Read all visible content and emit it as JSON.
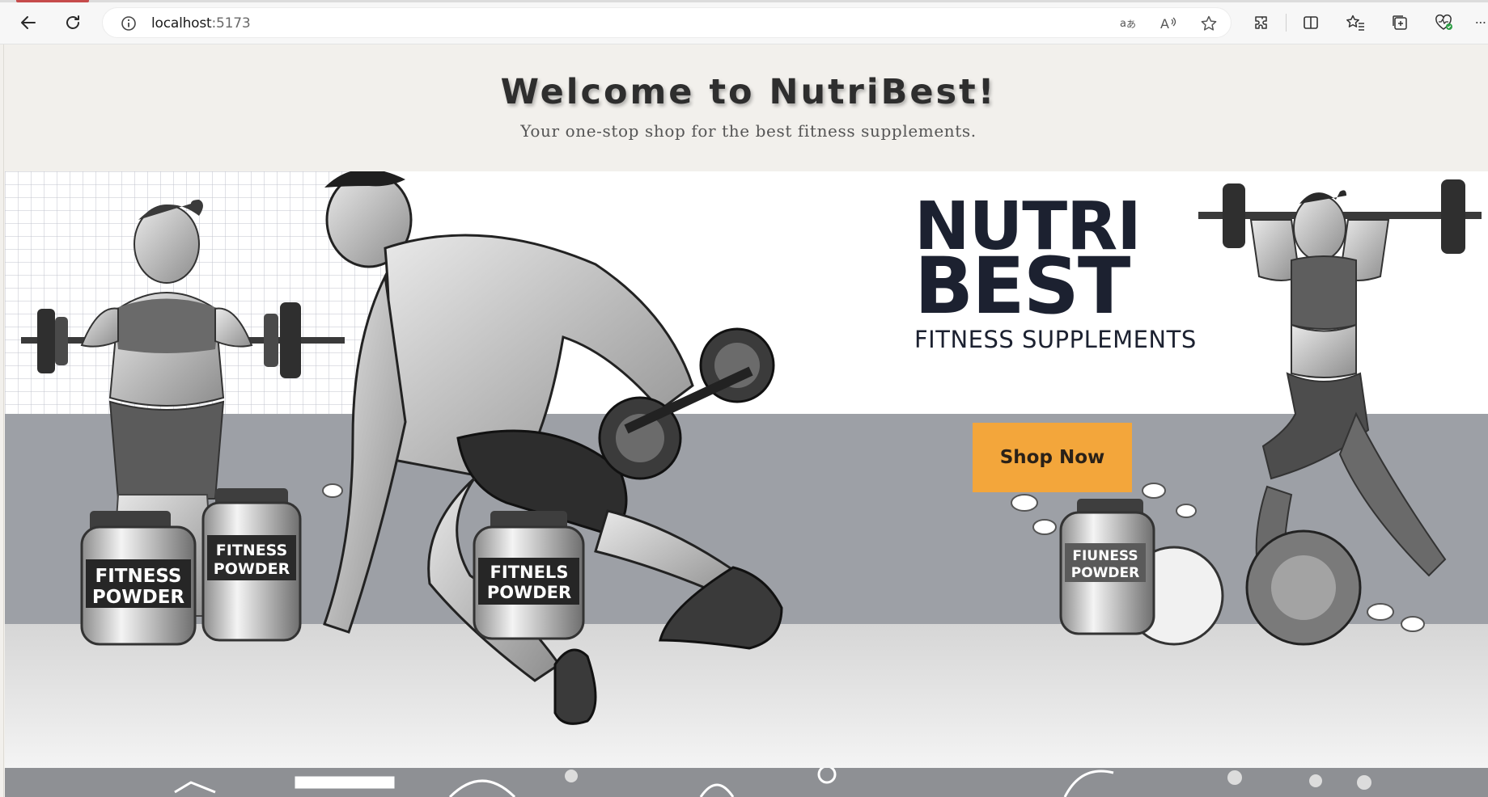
{
  "browser": {
    "url_host": "localhost",
    "url_port": ":5173"
  },
  "page": {
    "title": "Welcome to NutriBest!",
    "subtitle": "Your one-stop shop for the best fitness supplements."
  },
  "hero": {
    "brand_line1": "NUTRI",
    "brand_line2": "BEST",
    "tagline": "FITNESS SUPPLEMENTS",
    "cta_label": "Shop Now",
    "jar_labels": [
      {
        "line1": "FITNESS",
        "line2": "POWDER"
      },
      {
        "line1": "FITNESS",
        "line2": "POWDER"
      },
      {
        "line1": "FITNELS",
        "line2": "POWDER"
      },
      {
        "line1": "FIUNESS",
        "line2": "POWDER"
      }
    ]
  },
  "colors": {
    "accent": "#f3a63b",
    "title": "#2e2e2e",
    "brand_navy": "#1c2130"
  }
}
